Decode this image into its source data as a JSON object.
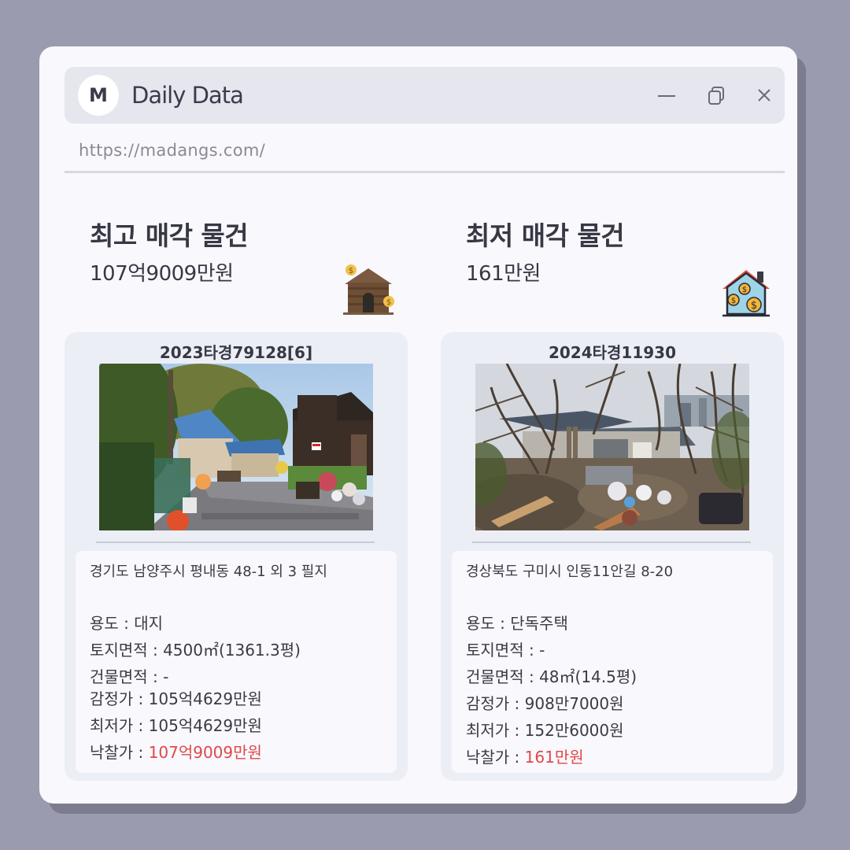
{
  "app": {
    "logo_letter": "M",
    "title": "Daily Data",
    "url": "https://madangs.com/"
  },
  "colors": {
    "accent": "#e04848",
    "background": "#9a9bae",
    "window": "#f8f8fd"
  },
  "highest": {
    "title": "최고 매각 물건",
    "price": "107억9009만원",
    "icon": "house-coin-icon",
    "case_no": "2023타경79128[6]",
    "photo": "village-street-photo",
    "address": "경기도 남양주시 평내동 48-1 외 3 필지",
    "usage_label": "용도 : ",
    "usage_value": "대지",
    "land_label": "토지면적 : ",
    "land_value": "4500㎡(1361.3평)",
    "building_label": "건물면적 : ",
    "building_value": "-",
    "appraisal_label": "감정가 : ",
    "appraisal_value": "105억4629만원",
    "minimum_label": "최저가 : ",
    "minimum_value": "105억4629만원",
    "winning_label": "낙찰가 : ",
    "winning_value": "107억9009만원"
  },
  "lowest": {
    "title": "최저 매각 물건",
    "price": "161만원",
    "icon": "house-money-icon",
    "case_no": "2024타경11930",
    "photo": "ruined-house-photo",
    "address": "경상북도 구미시 인동11안길 8-20",
    "usage_label": "용도 : ",
    "usage_value": "단독주택",
    "land_label": "토지면적 : ",
    "land_value": "-",
    "building_label": "건물면적 : ",
    "building_value": "48㎡(14.5평)",
    "appraisal_label": "감정가 : ",
    "appraisal_value": "908만7000원",
    "minimum_label": "최저가 : ",
    "minimum_value": "152만6000원",
    "winning_label": "낙찰가 : ",
    "winning_value": "161만원"
  }
}
